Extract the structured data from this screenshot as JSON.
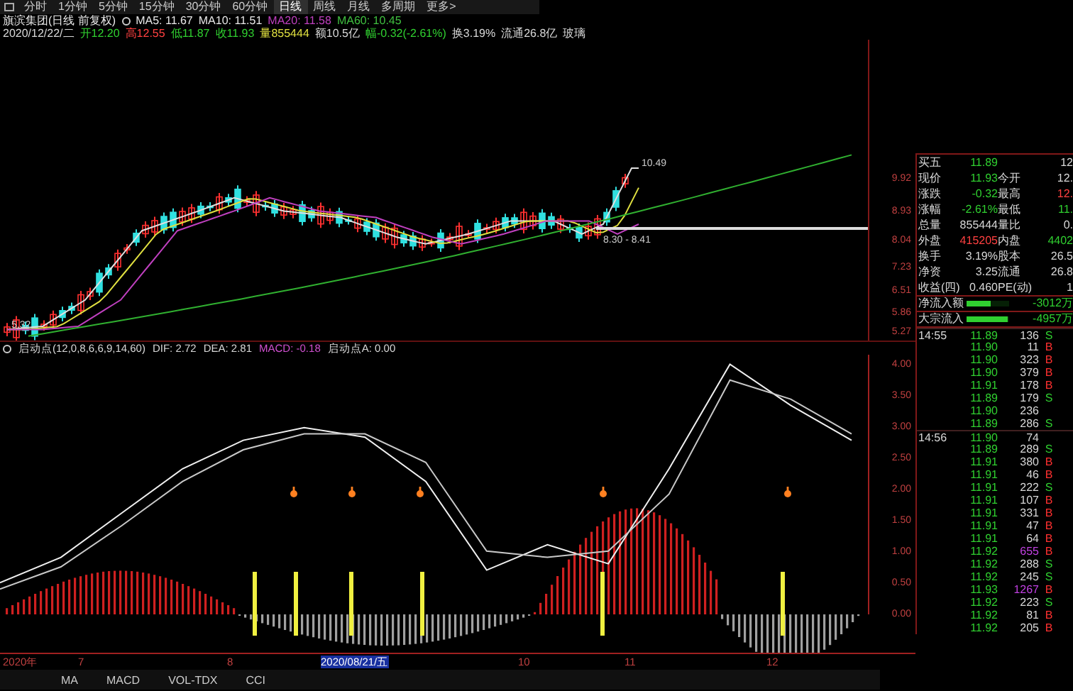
{
  "tabs": [
    {
      "label": "分时",
      "selected": false
    },
    {
      "label": "1分钟",
      "selected": false
    },
    {
      "label": "5分钟",
      "selected": false
    },
    {
      "label": "15分钟",
      "selected": false
    },
    {
      "label": "30分钟",
      "selected": false
    },
    {
      "label": "60分钟",
      "selected": false
    },
    {
      "label": "日线",
      "selected": true
    },
    {
      "label": "周线",
      "selected": false
    },
    {
      "label": "月线",
      "selected": false
    },
    {
      "label": "多周期",
      "selected": false
    },
    {
      "label": "更多>",
      "selected": false
    }
  ],
  "header": {
    "title": "旗滨集团(日线 前复权)",
    "averages": [
      {
        "label": "MA5: 11.67",
        "color": "#e8e8e8"
      },
      {
        "label": "MA10: 11.51",
        "color": "#e8e8e8"
      },
      {
        "label": "MA20: 11.58",
        "color": "#c040c0"
      },
      {
        "label": "MA60: 10.45",
        "color": "#40c040"
      }
    ],
    "bar_info": [
      {
        "text": "2020/12/22/二",
        "color": "#d8d8d8"
      },
      {
        "text": "开12.20",
        "color": "#30d030"
      },
      {
        "text": "高12.55",
        "color": "#ff4040"
      },
      {
        "text": "低11.87",
        "color": "#30d030"
      },
      {
        "text": "收11.93",
        "color": "#30d030"
      },
      {
        "text": "量855444",
        "color": "#e0e040"
      },
      {
        "text": "额10.5亿",
        "color": "#d8d8d8"
      },
      {
        "text": "幅-0.32(-2.61%)",
        "color": "#30d030"
      },
      {
        "text": "换3.19%",
        "color": "#d8d8d8"
      },
      {
        "text": "流通26.8亿",
        "color": "#d8d8d8"
      },
      {
        "text": "玻璃",
        "color": "#d8d8d8"
      }
    ]
  },
  "price_chart": {
    "axis": [
      "9.92",
      "8.93",
      "8.04",
      "7.23",
      "6.51",
      "5.86",
      "5.27"
    ],
    "high_label": "10.49",
    "low_label": "8.30 - 8.41",
    "start_label": "5.32"
  },
  "indicator": {
    "parts": [
      {
        "text": "启动点(12,0,8,6,6,9,14,60)",
        "color": "#d8d8d8"
      },
      {
        "text": "DIF: 2.72",
        "color": "#d8d8d8"
      },
      {
        "text": "DEA: 2.81",
        "color": "#d8d8d8"
      },
      {
        "text": "MACD: -0.18",
        "color": "#d050d0"
      },
      {
        "text": "启动点A: 0.00",
        "color": "#d8d8d8"
      }
    ],
    "chart_data": {
      "type": "line",
      "ylim": [
        0,
        4.1
      ],
      "yticks": [
        {
          "value": 4,
          "label": "4.00"
        },
        {
          "value": 3.5,
          "label": "3.50"
        },
        {
          "value": 3,
          "label": "3.00"
        },
        {
          "value": 2.5,
          "label": "2.50"
        },
        {
          "value": 2,
          "label": "2.00"
        },
        {
          "value": 1.5,
          "label": "1.50"
        },
        {
          "value": 1,
          "label": "1.00"
        },
        {
          "value": 0.5,
          "label": "0.50"
        },
        {
          "value": 0,
          "label": "0.00"
        }
      ],
      "series": [
        {
          "color": "#f0f0f0",
          "values": [
            0.5,
            0.9,
            1.6,
            2.3,
            2.75,
            2.95,
            2.8,
            2.1,
            0.7,
            1.1,
            0.8,
            2.3,
            3.95,
            3.3,
            2.75
          ]
        },
        {
          "color": "#c8c8c8",
          "values": [
            0.4,
            0.75,
            1.4,
            2.1,
            2.6,
            2.85,
            2.85,
            2.4,
            1.0,
            0.9,
            1.0,
            1.9,
            3.7,
            3.4,
            2.85
          ]
        }
      ]
    }
  },
  "date_axis": [
    {
      "label": "2020年",
      "selected": false
    },
    {
      "label": "7",
      "selected": false
    },
    {
      "label": "8",
      "selected": false
    },
    {
      "label": "2020/08/21/五",
      "selected": true
    },
    {
      "label": "10",
      "selected": false
    },
    {
      "label": "11",
      "selected": false
    },
    {
      "label": "12",
      "selected": false
    }
  ],
  "quote": [
    {
      "cells": [
        {
          "label": "买五",
          "value": "11.89",
          "color": "#30d030"
        },
        {
          "value": "12",
          "color": "#d8d8d8"
        }
      ]
    },
    {
      "cells": [
        {
          "label": "现价",
          "value": "11.93",
          "color": "#30d030"
        },
        {
          "label": "今开",
          "value": "12.",
          "color": "#d8d8d8"
        }
      ]
    },
    {
      "cells": [
        {
          "label": "涨跌",
          "value": "-0.32",
          "color": "#30d030"
        },
        {
          "label": "最高",
          "value": "12.",
          "color": "#ff4040"
        }
      ]
    },
    {
      "cells": [
        {
          "label": "涨幅",
          "value": "-2.61%",
          "color": "#30d030"
        },
        {
          "label": "最低",
          "value": "11.",
          "color": "#30d030"
        }
      ]
    },
    {
      "cells": [
        {
          "label": "总量",
          "value": "855444",
          "color": "#d8d8d8"
        },
        {
          "label": "量比",
          "value": "0.",
          "color": "#d8d8d8"
        }
      ]
    },
    {
      "cells": [
        {
          "label": "外盘",
          "value": "415205",
          "color": "#ff4040"
        },
        {
          "label": "内盘",
          "value": "4402",
          "color": "#30d030"
        }
      ]
    },
    {
      "cells": [
        {
          "label": "换手",
          "value": "3.19%",
          "color": "#d8d8d8"
        },
        {
          "label": "股本",
          "value": "26.5",
          "color": "#d8d8d8"
        }
      ]
    },
    {
      "cells": [
        {
          "label": "净资",
          "value": "3.25",
          "color": "#d8d8d8"
        },
        {
          "label": "流通",
          "value": "26.8",
          "color": "#d8d8d8"
        }
      ]
    },
    {
      "cells": [
        {
          "label": "收益(四)",
          "value": "0.460",
          "color": "#d8d8d8"
        },
        {
          "label": "PE(动)",
          "value": "1",
          "color": "#d8d8d8"
        }
      ]
    }
  ],
  "flows": [
    {
      "label": "净流入额",
      "level": 0.55,
      "value": "-3012万"
    },
    {
      "label": "大宗流入",
      "level": 0.95,
      "value": "-4957万"
    }
  ],
  "trades": [
    {
      "time": "14:55",
      "price": "11.89",
      "volume": "136",
      "side": "S",
      "large": false
    },
    {
      "price": "11.90",
      "volume": "11",
      "side": "B",
      "large": false
    },
    {
      "price": "11.90",
      "volume": "323",
      "side": "B",
      "large": false
    },
    {
      "price": "11.90",
      "volume": "379",
      "side": "B",
      "large": false
    },
    {
      "price": "11.91",
      "volume": "178",
      "side": "B",
      "large": false
    },
    {
      "price": "11.89",
      "volume": "179",
      "side": "S",
      "large": false
    },
    {
      "price": "11.90",
      "volume": "236",
      "large": false
    },
    {
      "price": "11.89",
      "volume": "286",
      "side": "S",
      "large": false
    },
    {
      "time": "14:56",
      "price": "11.90",
      "volume": "74",
      "large": false
    },
    {
      "price": "11.89",
      "volume": "289",
      "side": "S",
      "large": false
    },
    {
      "price": "11.91",
      "volume": "380",
      "side": "B",
      "large": false
    },
    {
      "price": "11.91",
      "volume": "46",
      "side": "B",
      "large": false
    },
    {
      "price": "11.91",
      "volume": "222",
      "side": "S",
      "large": false
    },
    {
      "price": "11.91",
      "volume": "107",
      "side": "B",
      "large": false
    },
    {
      "price": "11.91",
      "volume": "331",
      "side": "B",
      "large": false
    },
    {
      "price": "11.91",
      "volume": "47",
      "side": "B",
      "large": false
    },
    {
      "price": "11.91",
      "volume": "64",
      "side": "B",
      "large": false
    },
    {
      "price": "11.92",
      "volume": "655",
      "side": "B",
      "large": true
    },
    {
      "price": "11.92",
      "volume": "288",
      "side": "S",
      "large": false
    },
    {
      "price": "11.92",
      "volume": "245",
      "side": "S",
      "large": false
    },
    {
      "price": "11.93",
      "volume": "1267",
      "side": "B",
      "large": true
    },
    {
      "price": "11.92",
      "volume": "223",
      "side": "S",
      "large": false
    },
    {
      "price": "11.92",
      "volume": "81",
      "side": "B",
      "large": false
    },
    {
      "price": "11.92",
      "volume": "205",
      "side": "B",
      "large": false
    }
  ],
  "bottom_tabs": [
    {
      "label": "MA",
      "selected": false
    },
    {
      "label": "MACD",
      "selected": false
    },
    {
      "label": "VOL-TDX",
      "selected": false
    },
    {
      "label": "CCI",
      "selected": false
    }
  ]
}
